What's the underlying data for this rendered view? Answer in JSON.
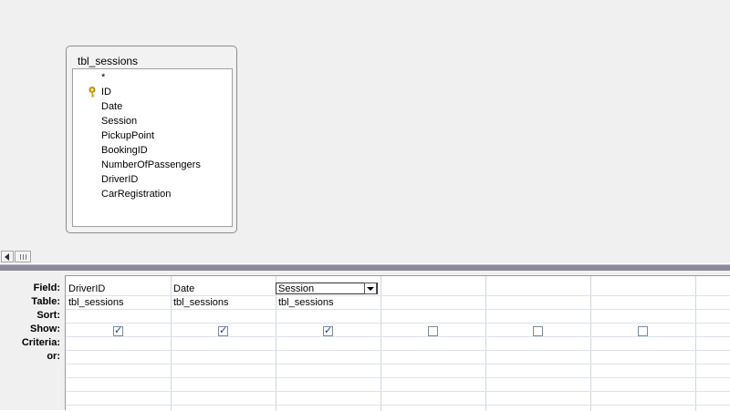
{
  "table_box": {
    "title": "tbl_sessions",
    "fields": [
      "*",
      "ID",
      "Date",
      "Session",
      "PickupPoint",
      "BookingID",
      "NumberOfPassengers",
      "DriverID",
      "CarRegistration"
    ],
    "primary_key_field": "ID"
  },
  "grid": {
    "row_labels": [
      "Field:",
      "Table:",
      "Sort:",
      "Show:",
      "Criteria:",
      "or:"
    ],
    "columns": [
      {
        "field": "DriverID",
        "table": "tbl_sessions",
        "show": true
      },
      {
        "field": "Date",
        "table": "tbl_sessions",
        "show": true
      },
      {
        "field": "Session",
        "table": "tbl_sessions",
        "show": true,
        "active": true
      },
      {
        "field": "",
        "table": "",
        "show": false
      },
      {
        "field": "",
        "table": "",
        "show": false
      },
      {
        "field": "",
        "table": "",
        "show": false
      }
    ]
  },
  "colors": {
    "pane_bg": "#f0f0f0",
    "splitter": "#8b8a99",
    "check": "#1a3a8a"
  },
  "icons": {
    "key": "key-icon",
    "scroll_left": "scroll-left-arrow-icon",
    "dropdown": "chevron-down-icon"
  }
}
